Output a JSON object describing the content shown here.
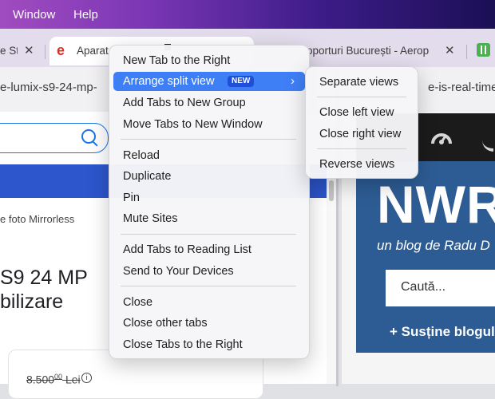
{
  "menubar": {
    "items": [
      "Window",
      "Help"
    ]
  },
  "tabs": [
    {
      "label": "e St",
      "close": "✕"
    },
    {
      "label": "Aparat",
      "close": "✕",
      "favicon": "e"
    },
    {
      "label": "oporturi București - Aerop",
      "close": "✕"
    }
  ],
  "favicon_colors": {
    "active_tab": "#d93025",
    "extension": "#4caf50"
  },
  "address": {
    "left": "e-lumix-s9-24-mp-",
    "right": "e-is-real-time"
  },
  "left_page": {
    "crumb": "e foto Mirrorless",
    "title_line1": "S9 24 MP",
    "title_line2": "bilizare",
    "old_price": "8.500",
    "old_price_decimals": "00",
    "currency": "Lei",
    "info_glyph": "i"
  },
  "right_page": {
    "logo": "NWR",
    "tagline": "un blog de Radu D",
    "search_placeholder": "Caută...",
    "support": "+ Susține blogul"
  },
  "context_menu": {
    "items": [
      "New Tab to the Right",
      "Arrange split view",
      "Add Tabs to New Group",
      "Move Tabs to New Window",
      "Reload",
      "Duplicate",
      "Pin",
      "Mute Sites",
      "Add Tabs to Reading List",
      "Send to Your Devices",
      "Close",
      "Close other tabs",
      "Close Tabs to the Right"
    ],
    "new_badge": "NEW",
    "chevron": "›"
  },
  "submenu": {
    "items": [
      "Separate views",
      "Close left view",
      "Close right view",
      "Reverse views"
    ]
  },
  "colors": {
    "highlight": "#3f7ff6",
    "badge": "#1f4fd6",
    "blog_panel": "#2d5c94"
  }
}
